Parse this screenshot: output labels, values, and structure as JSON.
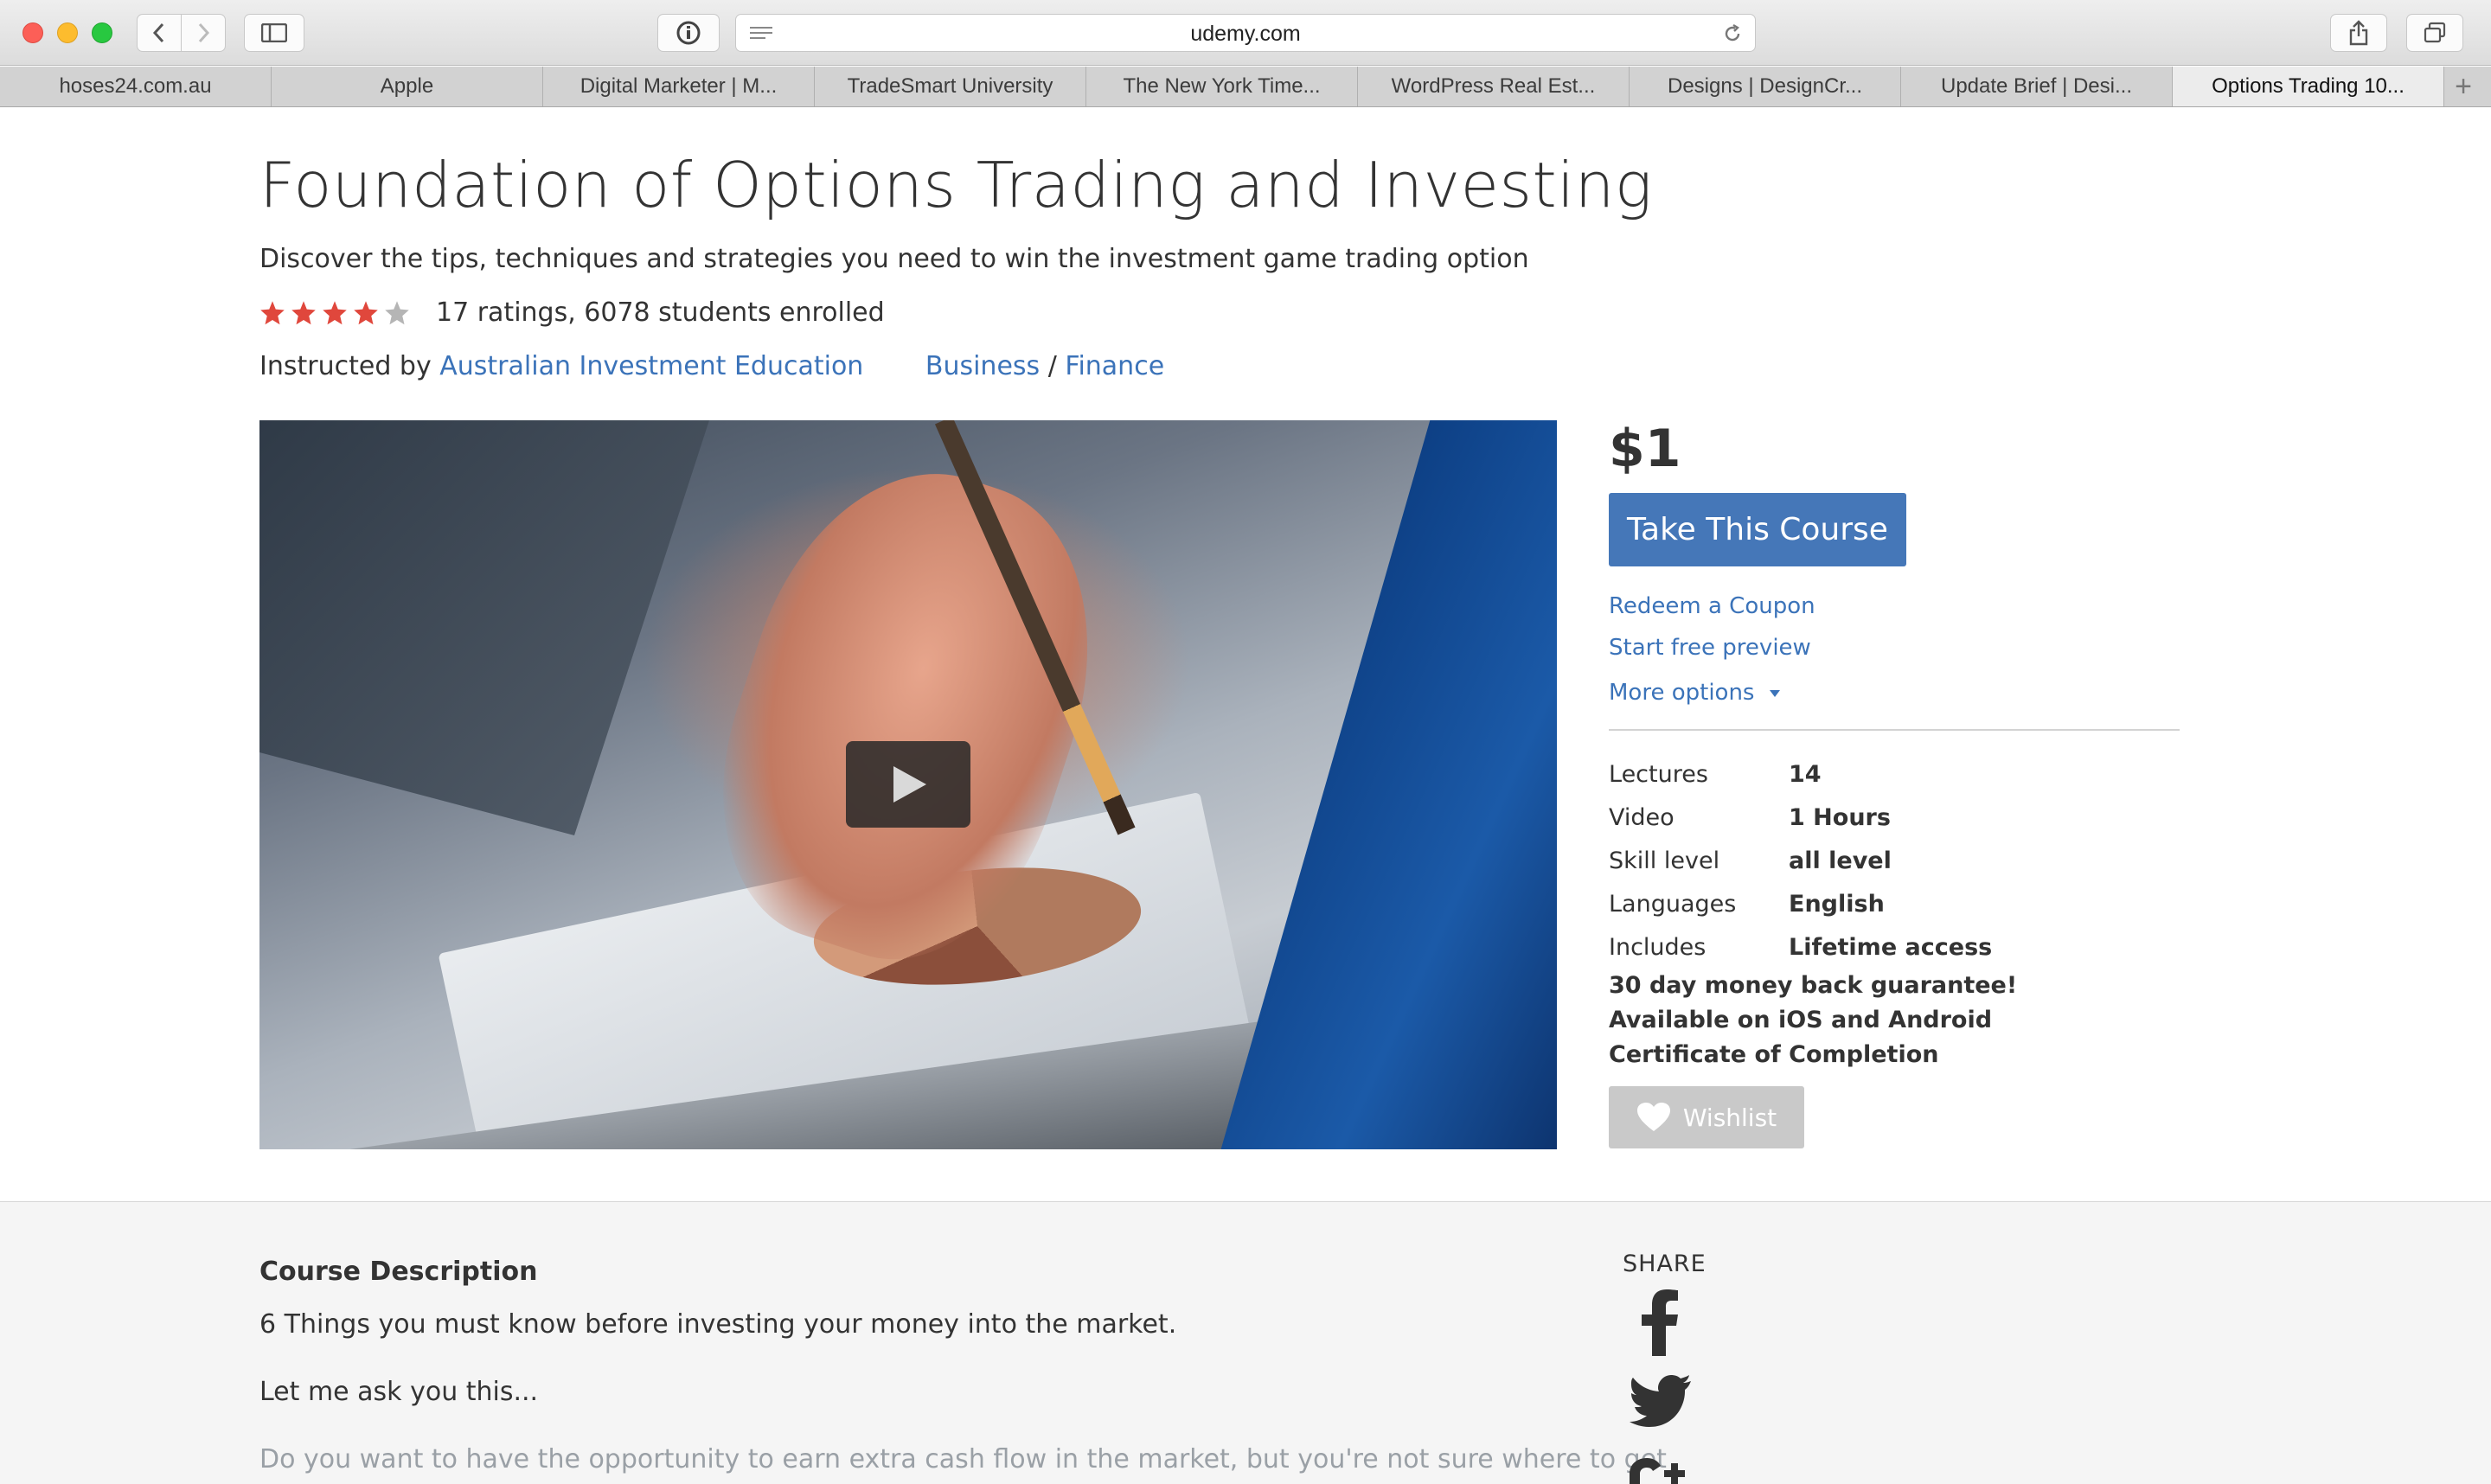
{
  "browser": {
    "url": "udemy.com",
    "tabs": [
      {
        "label": "hoses24.com.au",
        "active": false
      },
      {
        "label": "Apple",
        "active": false
      },
      {
        "label": "Digital Marketer | M...",
        "active": false
      },
      {
        "label": "TradeSmart University",
        "active": false
      },
      {
        "label": "The New York Time...",
        "active": false
      },
      {
        "label": "WordPress Real Est...",
        "active": false
      },
      {
        "label": "Designs | DesignCr...",
        "active": false
      },
      {
        "label": "Update Brief | Desi...",
        "active": false
      },
      {
        "label": "Options Trading 10...",
        "active": true
      }
    ],
    "new_tab_label": "+"
  },
  "course": {
    "title": "Foundation of Options Trading and Investing",
    "subtitle": "Discover the tips, techniques and strategies you need to win the investment game trading option",
    "rating_stars": 4,
    "rating_text": "17 ratings, 6078 students enrolled",
    "instructed_by": "Instructed by",
    "instructor": "Australian Investment Education",
    "category": "Business",
    "category_sep": "/",
    "subcategory": "Finance"
  },
  "purchase": {
    "price": "$1",
    "take_course": "Take This Course",
    "redeem": "Redeem a Coupon",
    "preview": "Start free preview",
    "more_options": "More options"
  },
  "details": [
    {
      "label": "Lectures",
      "value": "14"
    },
    {
      "label": "Video",
      "value": "1 Hours"
    },
    {
      "label": "Skill level",
      "value": "all level"
    },
    {
      "label": "Languages",
      "value": "English"
    },
    {
      "label": "Includes",
      "value": "Lifetime access"
    }
  ],
  "extras": [
    "30 day money back guarantee!",
    "Available on iOS and Android",
    "Certificate of Completion"
  ],
  "wishlist": "Wishlist",
  "description": {
    "heading": "Course Description",
    "p1": "6 Things you must know before investing your money into the market.",
    "p2": "Let me ask you this...",
    "p3": "Do you want to have the opportunity to earn extra cash flow in the market, but you're not sure where to get"
  },
  "share": {
    "label": "SHARE",
    "networks": [
      "facebook-icon",
      "twitter-icon",
      "google-plus-icon"
    ]
  },
  "colors": {
    "link": "#3b73b9",
    "button": "#4577b8",
    "star": "#e0473c",
    "star_empty": "#b5b5b5"
  }
}
